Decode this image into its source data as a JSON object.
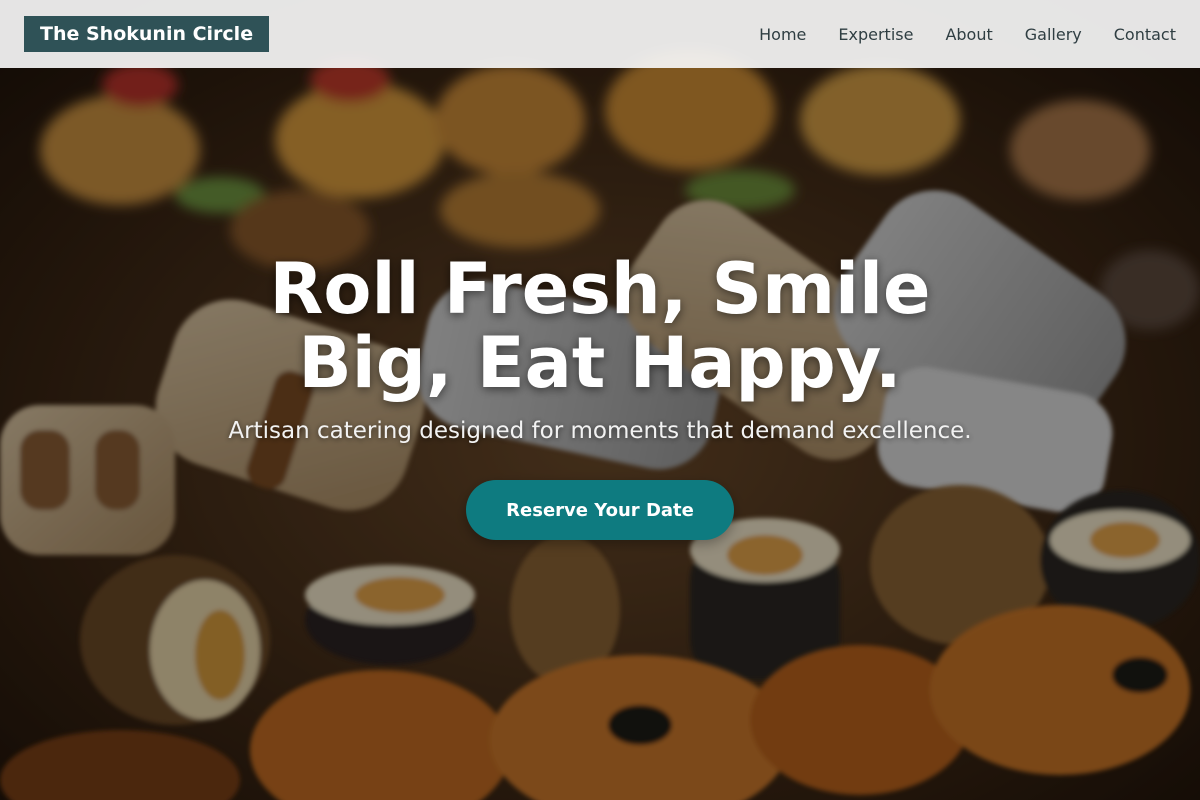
{
  "header": {
    "logo_text": "The Shokunin Circle",
    "nav": [
      {
        "label": "Home"
      },
      {
        "label": "Expertise"
      },
      {
        "label": "About"
      },
      {
        "label": "Gallery"
      },
      {
        "label": "Contact"
      }
    ]
  },
  "hero": {
    "headline": "Roll Fresh, Smile Big, Eat Happy.",
    "subheadline": "Artisan catering designed for moments that demand excellence.",
    "cta_label": "Reserve Your Date",
    "background": "photo of wraps in newspaper, sushi rolls and pastries"
  },
  "colors": {
    "logo_bg": "#2f5257",
    "nav_text": "#2f3e42",
    "cta_bg": "#0e7b80",
    "headline_text": "#ffffff"
  }
}
